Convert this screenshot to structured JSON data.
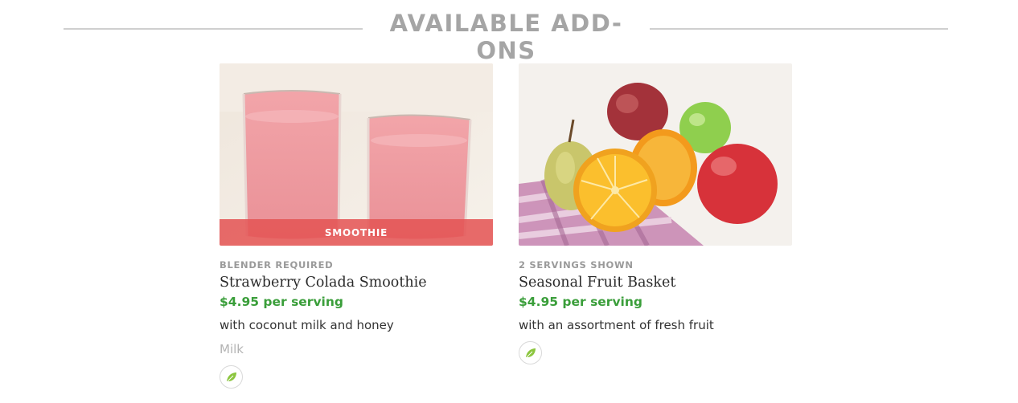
{
  "section": {
    "title": "AVAILABLE ADD-ONS"
  },
  "addons": [
    {
      "image_alt": "Two glasses of pink strawberry smoothie",
      "badge": "SMOOTHIE",
      "eyebrow": "BLENDER REQUIRED",
      "name": "Strawberry Colada Smoothie",
      "price": "$4.95 per serving",
      "description": "with coconut milk and honey",
      "allergen": "Milk",
      "icon": "leaf-icon"
    },
    {
      "image_alt": "Pears, apples and halved oranges on a checkered cloth",
      "eyebrow": "2 SERVINGS SHOWN",
      "name": "Seasonal Fruit Basket",
      "price": "$4.95 per serving",
      "description": "with an assortment of fresh fruit",
      "icon": "leaf-icon"
    }
  ],
  "colors": {
    "price": "#3a9e3a",
    "badge": "#e45454",
    "header_text": "#a5a5a5",
    "rule": "#cfcfcf",
    "leaf": "#8cc63f"
  }
}
